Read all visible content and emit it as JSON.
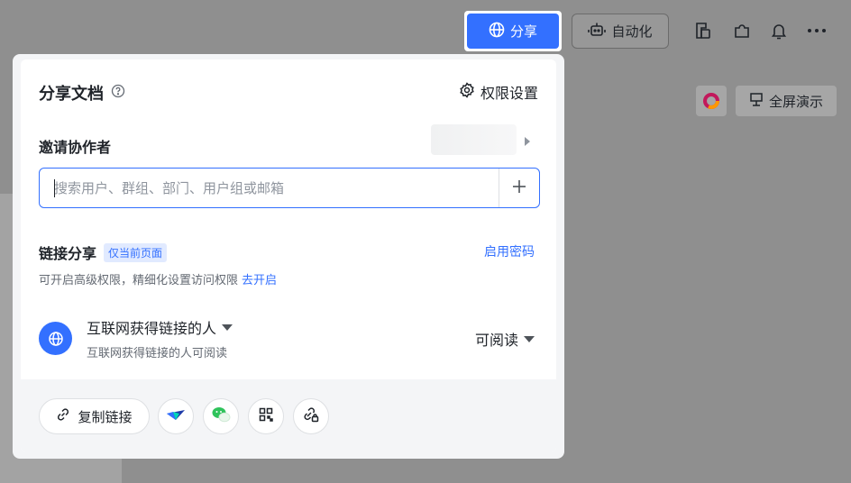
{
  "toolbar": {
    "share_label": "分享",
    "automation_label": "自动化",
    "icons": [
      "doc-outline-icon",
      "plugin-icon",
      "bell-icon",
      "more-icon"
    ]
  },
  "background": {
    "fullscreen_label": "全屏演示"
  },
  "panel": {
    "title": "分享文档",
    "permission_settings_label": "权限设置",
    "invite_label": "邀请协作者",
    "search_placeholder": "搜索用户、群组、部门、用户组或邮箱",
    "link_share_label": "链接分享",
    "link_share_badge": "仅当前页面",
    "enable_password_label": "启用密码",
    "advanced_hint": "可开启高级权限，精细化设置访问权限",
    "advanced_link": "去开启",
    "scope_title": "互联网获得链接的人",
    "scope_subtitle": "互联网获得链接的人可阅读",
    "permission_value": "可阅读",
    "copy_link_label": "复制链接"
  },
  "colors": {
    "accent": "#3370ff",
    "text": "#1f2329",
    "muted": "#646a73"
  }
}
